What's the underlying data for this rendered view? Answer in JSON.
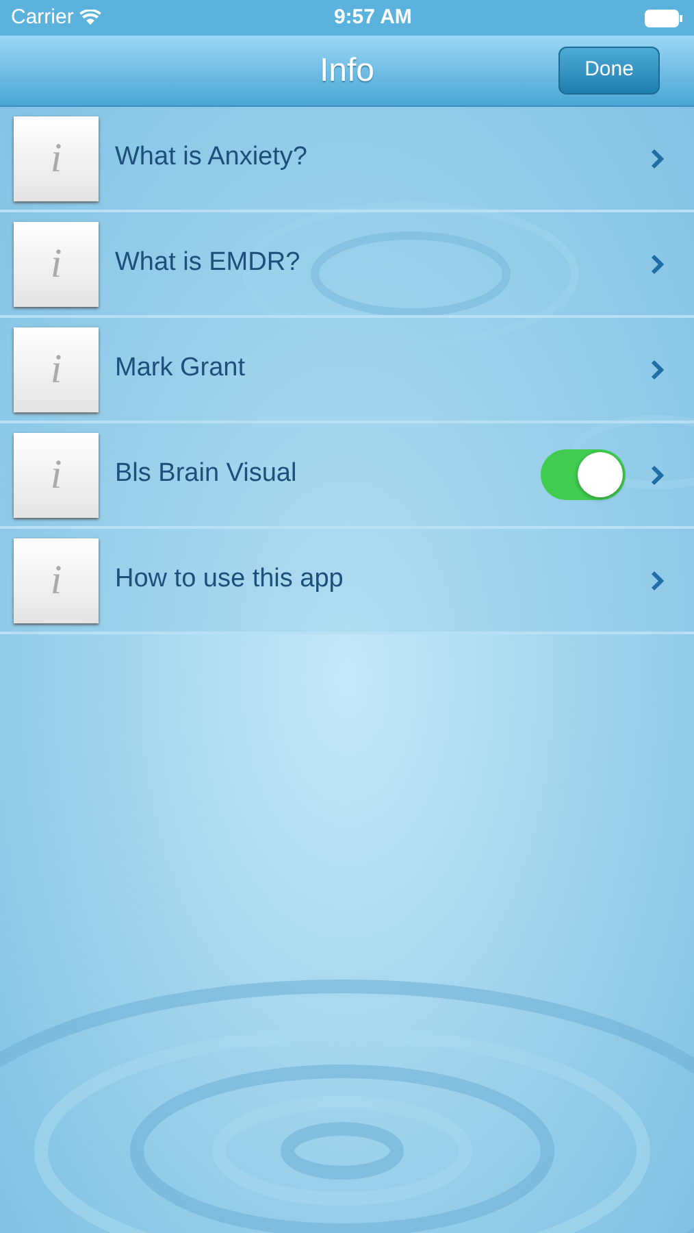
{
  "status_bar": {
    "carrier": "Carrier",
    "time": "9:57 AM"
  },
  "nav_bar": {
    "title": "Info",
    "done_button": "Done"
  },
  "items": [
    {
      "kind": "link",
      "icon": "i",
      "label": "What is Anxiety?"
    },
    {
      "kind": "link",
      "icon": "i",
      "label": "What is EMDR?"
    },
    {
      "kind": "link",
      "icon": "i",
      "label": "Mark Grant"
    },
    {
      "kind": "toggle",
      "icon": "i",
      "label": "Bls Brain Visual",
      "on": true
    },
    {
      "kind": "link",
      "icon": "i",
      "label": "How to use this app"
    }
  ]
}
